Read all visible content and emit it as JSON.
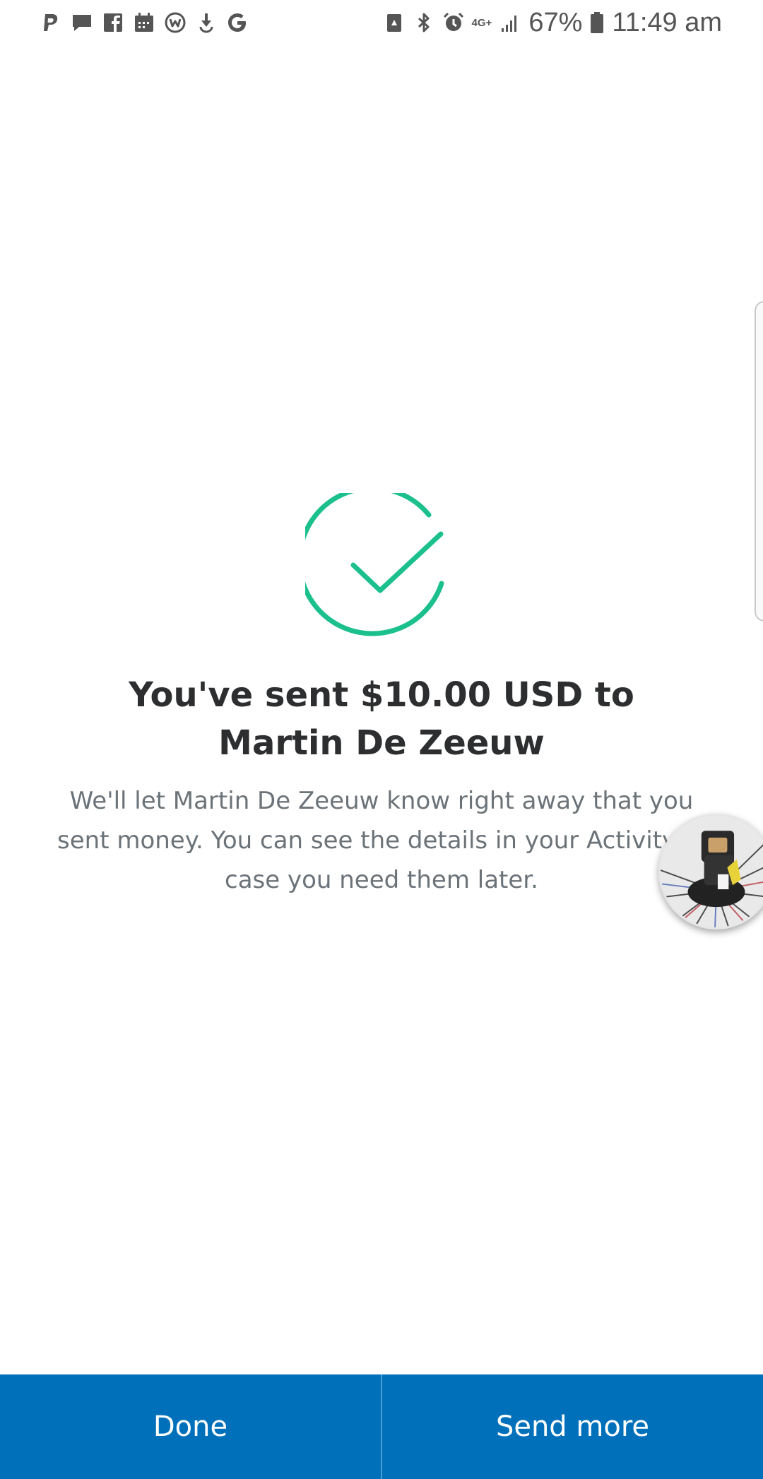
{
  "status_bar": {
    "left_icons": [
      "paypal-icon",
      "message-icon",
      "facebook-icon",
      "calendar-icon",
      "workplace-icon",
      "download-icon",
      "google-icon"
    ],
    "right_icons": [
      "nfc-icon",
      "bluetooth-icon",
      "alarm-icon"
    ],
    "network": "4G+",
    "battery_percent": "67%",
    "time": "11:49 am"
  },
  "success": {
    "icon": "check-circle-icon",
    "accent_color": "#1cc08d",
    "headline": "You've sent $10.00 USD to Martin De Zeeuw",
    "description": "We'll let Martin De Zeeuw know right away that you sent money. You can see the details in your Activity in case you need them later."
  },
  "chat_head": {
    "icon": "chat-head-avatar"
  },
  "actions": {
    "done_label": "Done",
    "send_more_label": "Send more",
    "bar_color": "#0070ba"
  }
}
